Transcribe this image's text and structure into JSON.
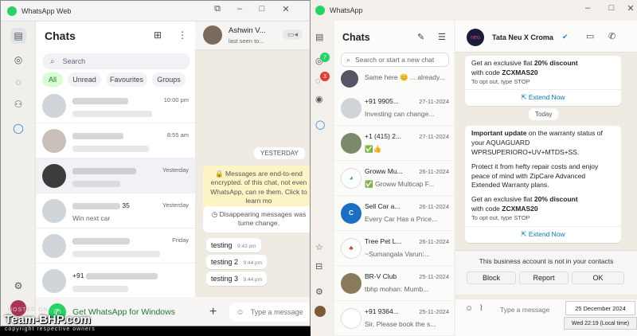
{
  "left_window": {
    "title": "WhatsApp Web",
    "chats_header": "Chats",
    "search_placeholder": "Search",
    "filters": [
      "All",
      "Unread",
      "Favourites",
      "Groups"
    ],
    "chats": [
      {
        "time": "10:00 pm"
      },
      {
        "time": "8:55 am"
      },
      {
        "time": "Yesterday"
      },
      {
        "name_fragment": "35",
        "preview_fragment": "Win next car",
        "time": "Yesterday"
      },
      {
        "time": "Friday"
      },
      {
        "name_fragment": "+91",
        "time": ""
      }
    ],
    "promo": "Get WhatsApp for Windows",
    "contact_name": "Ashwin V...",
    "contact_status": "last seen to...",
    "date_chip": "YESTERDAY",
    "encryption_notice": "Messages are end-to-end encrypted. of this chat, not even WhatsApp, can re them. Click to learn mo",
    "disappearing_notice": "Disappearing messages was turne change.",
    "messages": [
      {
        "text": "testing",
        "time": "9:43 pm"
      },
      {
        "text": "testing 2",
        "time": "9:44 pm"
      },
      {
        "text": "testing 3",
        "time": "9:44 pm"
      }
    ],
    "message_placeholder": "Type a message"
  },
  "right_window": {
    "title": "WhatsApp",
    "chats_header": "Chats",
    "search_placeholder": "Search or start a new chat",
    "rail_badges": [
      "7",
      "3"
    ],
    "chats": [
      {
        "name": "",
        "preview": "Same here 😊 ... already...",
        "time": ""
      },
      {
        "name": "+91 9905...",
        "preview": "Investing can change...",
        "time": "27-11-2024"
      },
      {
        "name": "+1 (415) 2...",
        "preview": "✅👍",
        "time": "27-11-2024"
      },
      {
        "name": "Groww Mu...",
        "preview": "✅ Groww Multicap F...",
        "time": "26-11-2024"
      },
      {
        "name": "Sell Car a...",
        "preview": "Every Car Has a Price...",
        "time": "26-11-2024"
      },
      {
        "name": "Tree Pet L...",
        "preview": "~Sumangala Varun:...",
        "time": "26-11-2024"
      },
      {
        "name": "BR-V Club",
        "preview": "tbhp mohan: Mumb...",
        "time": "25-11-2024"
      },
      {
        "name": "+91 9364...",
        "preview": "Sir, Please book the s...",
        "time": "25-11-2024"
      }
    ],
    "contact_name": "Tata Neu X Croma",
    "msg1_line1": "Get an exclusive flat ",
    "msg1_bold1": "20% discount",
    "msg1_line2": "with code ",
    "msg1_bold2": "ZCXMAS20",
    "msg1_optout": "To opt out, type STOP",
    "extend_now": "Extend Now",
    "today_chip": "Today",
    "msg2_bold": "Important update",
    "msg2_text": " on the warranty status of your AQUAGUARD WPRSUPERIORO+UV+MTDS+SS.",
    "msg2_para2": "Protect it from hefty repair costs and enjoy peace of mind with ZipCare Advanced Extended Warranty plans.",
    "msg2_line3": "Get an exclusive flat ",
    "msg2_bold3": "20% discount",
    "msg2_line4": "with code ",
    "msg2_bold4": "ZCXMAS20",
    "msg2_optout": "To opt out, type STOP",
    "extend_now_2": "Extend Now",
    "business_notice": "This business account is not in your contacts",
    "block_label": "Block",
    "report_label": "Report",
    "ok_label": "OK",
    "message_placeholder": "Type a message",
    "tooltip_date": "25 December 2024",
    "clock": "Wed 22:19 (Local time)"
  },
  "watermark": {
    "brand": "Team-BHP.com",
    "copyright": "copyright respective owners",
    "hosted": "HOSTED ON"
  },
  "colors": {
    "accent": "#25d366",
    "link": "#027eb5",
    "chip": "#d9fdd3"
  }
}
